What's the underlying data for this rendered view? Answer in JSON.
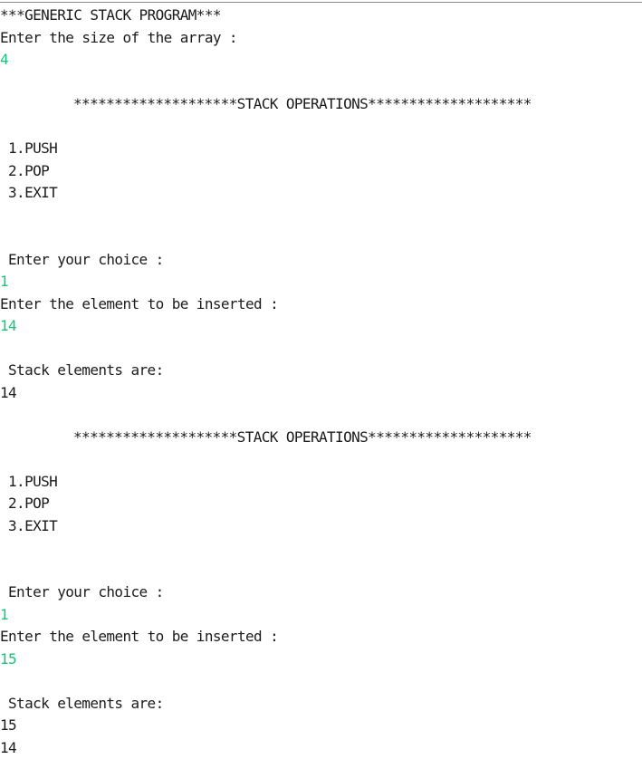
{
  "colors": {
    "output_text": "#1b1b1b",
    "user_input": "#17c27a",
    "background": "#ffffff"
  },
  "console": {
    "title": "***GENERIC STACK PROGRAM***",
    "size_prompt": "Enter the size of the array :",
    "size_input": "4",
    "blocks": [
      {
        "banner": "********************STACK OPERATIONS********************",
        "menu": [
          "1.PUSH",
          "2.POP",
          "3.EXIT"
        ],
        "choice_prompt": "Enter your choice :",
        "choice_input": "1",
        "element_prompt": "Enter the element to be inserted :",
        "element_input": "14",
        "stack_label": "Stack elements are:",
        "stack_values": [
          "14"
        ]
      },
      {
        "banner": "********************STACK OPERATIONS********************",
        "menu": [
          "1.PUSH",
          "2.POP",
          "3.EXIT"
        ],
        "choice_prompt": "Enter your choice :",
        "choice_input": "1",
        "element_prompt": "Enter the element to be inserted :",
        "element_input": "15",
        "stack_label": "Stack elements are:",
        "stack_values": [
          "15",
          "14"
        ]
      }
    ]
  }
}
